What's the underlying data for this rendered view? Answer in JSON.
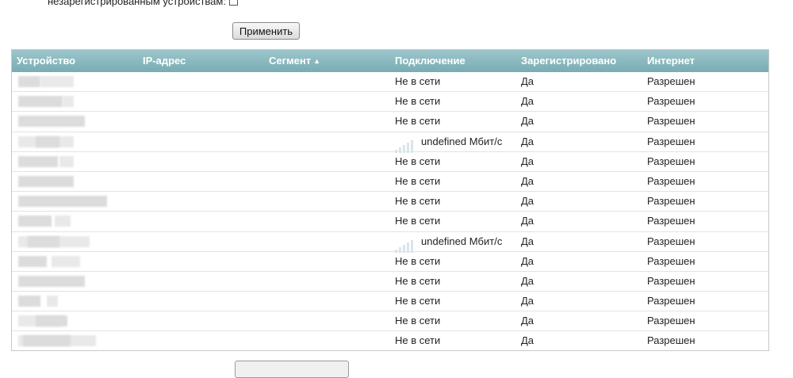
{
  "top_label": "незарегистрированным устройствам:",
  "apply_label": "Применить",
  "table": {
    "headers": [
      {
        "key": "device",
        "label": "Устройство"
      },
      {
        "key": "ip",
        "label": "IP-адрес"
      },
      {
        "key": "segment",
        "label": "Сегмент",
        "sort": "▲"
      },
      {
        "key": "connection",
        "label": "Подключение"
      },
      {
        "key": "registered",
        "label": "Зарегистрировано"
      },
      {
        "key": "internet",
        "label": "Интернет"
      }
    ],
    "rows": [
      {
        "connection": "Не в сети",
        "signal": false,
        "registered": "Да",
        "internet": "Разрешен"
      },
      {
        "connection": "Не в сети",
        "signal": false,
        "registered": "Да",
        "internet": "Разрешен"
      },
      {
        "connection": "Не в сети",
        "signal": false,
        "registered": "Да",
        "internet": "Разрешен"
      },
      {
        "connection": "undefined Мбит/с",
        "signal": true,
        "registered": "Да",
        "internet": "Разрешен"
      },
      {
        "connection": "Не в сети",
        "signal": false,
        "registered": "Да",
        "internet": "Разрешен"
      },
      {
        "connection": "Не в сети",
        "signal": false,
        "registered": "Да",
        "internet": "Разрешен"
      },
      {
        "connection": "Не в сети",
        "signal": false,
        "registered": "Да",
        "internet": "Разрешен"
      },
      {
        "connection": "Не в сети",
        "signal": false,
        "registered": "Да",
        "internet": "Разрешен"
      },
      {
        "connection": "undefined Мбит/с",
        "signal": true,
        "registered": "Да",
        "internet": "Разрешен"
      },
      {
        "connection": "Не в сети",
        "signal": false,
        "registered": "Да",
        "internet": "Разрешен"
      },
      {
        "connection": "Не в сети",
        "signal": false,
        "registered": "Да",
        "internet": "Разрешен"
      },
      {
        "connection": "Не в сети",
        "signal": false,
        "registered": "Да",
        "internet": "Разрешен"
      },
      {
        "connection": "Не в сети",
        "signal": false,
        "registered": "Да",
        "internet": "Разрешен"
      },
      {
        "connection": "Не в сети",
        "signal": false,
        "registered": "Да",
        "internet": "Разрешен"
      }
    ]
  },
  "colors": {
    "header_bg": "#86b6bd",
    "header_text": "#ffffff"
  }
}
